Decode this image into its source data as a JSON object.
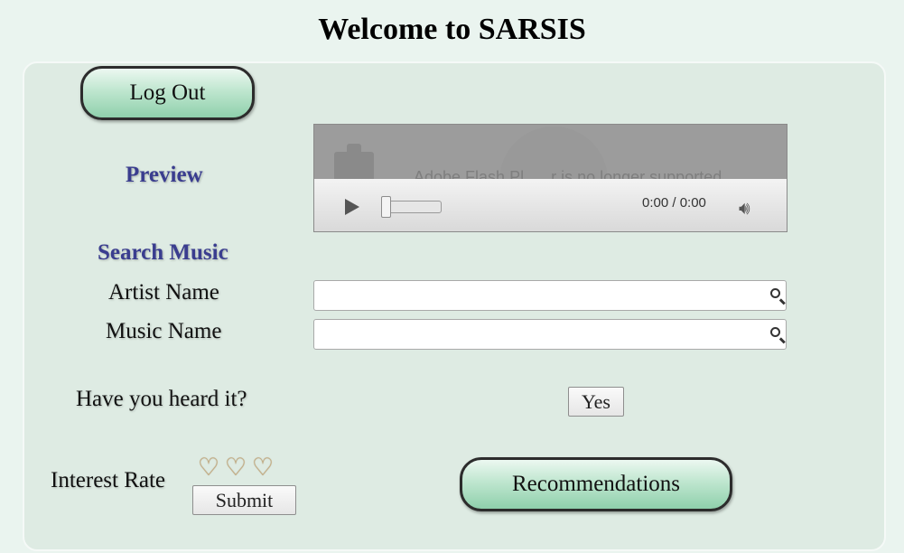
{
  "app": {
    "title": "Welcome to SARSIS"
  },
  "header": {
    "logout_label": "Log Out"
  },
  "preview": {
    "label": "Preview",
    "player": {
      "message": "Adobe Flash Pl___r is no longer supported",
      "time": "0:00 / 0:00",
      "icons": {
        "play": "play-icon",
        "volume": "volume-icon",
        "plugin": "plugin-icon"
      }
    }
  },
  "search": {
    "label": "Search Music",
    "artist": {
      "label": "Artist Name",
      "value": "",
      "placeholder": ""
    },
    "music": {
      "label": "Music Name",
      "value": "",
      "placeholder": ""
    }
  },
  "heard": {
    "question": "Have you heard it?",
    "yes_label": "Yes"
  },
  "interest": {
    "label": "Interest Rate",
    "rating": 0,
    "max_rating": 3,
    "submit_label": "Submit"
  },
  "recommendations": {
    "label": "Recommendations"
  },
  "colors": {
    "page_bg": "#eaf4ef",
    "panel_bg": "#deebe3",
    "accent_label": "#3a3d8f",
    "button_green": "#8fd0ac",
    "heart_tan": "#c9aa7c"
  }
}
